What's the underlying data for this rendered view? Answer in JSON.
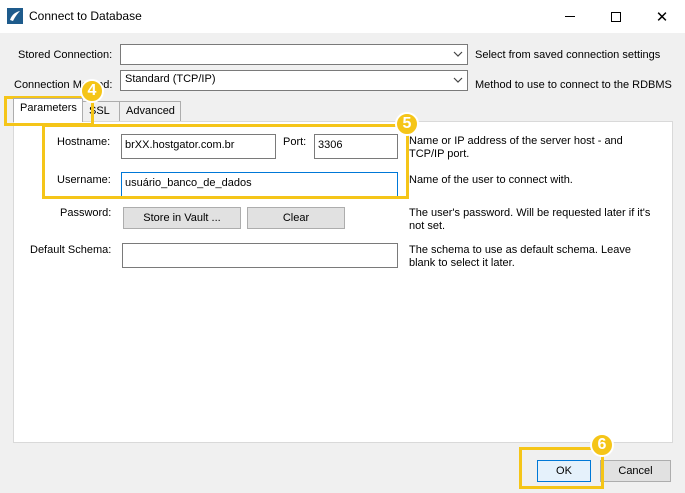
{
  "window": {
    "title": "Connect to Database",
    "icon": "mysql-workbench-icon",
    "controls": {
      "minimize": "minimize-icon",
      "maximize": "maximize-icon",
      "close": "✕"
    }
  },
  "stored_connection": {
    "label": "Stored Connection:",
    "value": "",
    "description": "Select from saved connection settings"
  },
  "connection_method": {
    "label": "Connection Method:",
    "value": "Standard (TCP/IP)",
    "description": "Method to use to connect to the RDBMS"
  },
  "tabs": [
    {
      "label": "Parameters",
      "active": true
    },
    {
      "label": "SSL",
      "active": false
    },
    {
      "label": "Advanced",
      "active": false
    }
  ],
  "parameters": {
    "hostname": {
      "label": "Hostname:",
      "value": "brXX.hostgator.com.br",
      "description": "Name or IP address of the server host - and TCP/IP port."
    },
    "port": {
      "label": "Port:",
      "value": "3306"
    },
    "username": {
      "label": "Username:",
      "value": "usuário_banco_de_dados",
      "description": "Name of the user to connect with."
    },
    "password": {
      "label": "Password:",
      "store_button": "Store in Vault ...",
      "clear_button": "Clear",
      "description": "The user's password. Will be requested later if it's not set."
    },
    "default_schema": {
      "label": "Default Schema:",
      "value": "",
      "description": "The schema to use as default schema. Leave blank to select it later."
    }
  },
  "buttons": {
    "ok": "OK",
    "cancel": "Cancel"
  },
  "annotations": {
    "tabs_badge": "4",
    "fields_badge": "5",
    "ok_badge": "6",
    "color": "#f5c518"
  }
}
